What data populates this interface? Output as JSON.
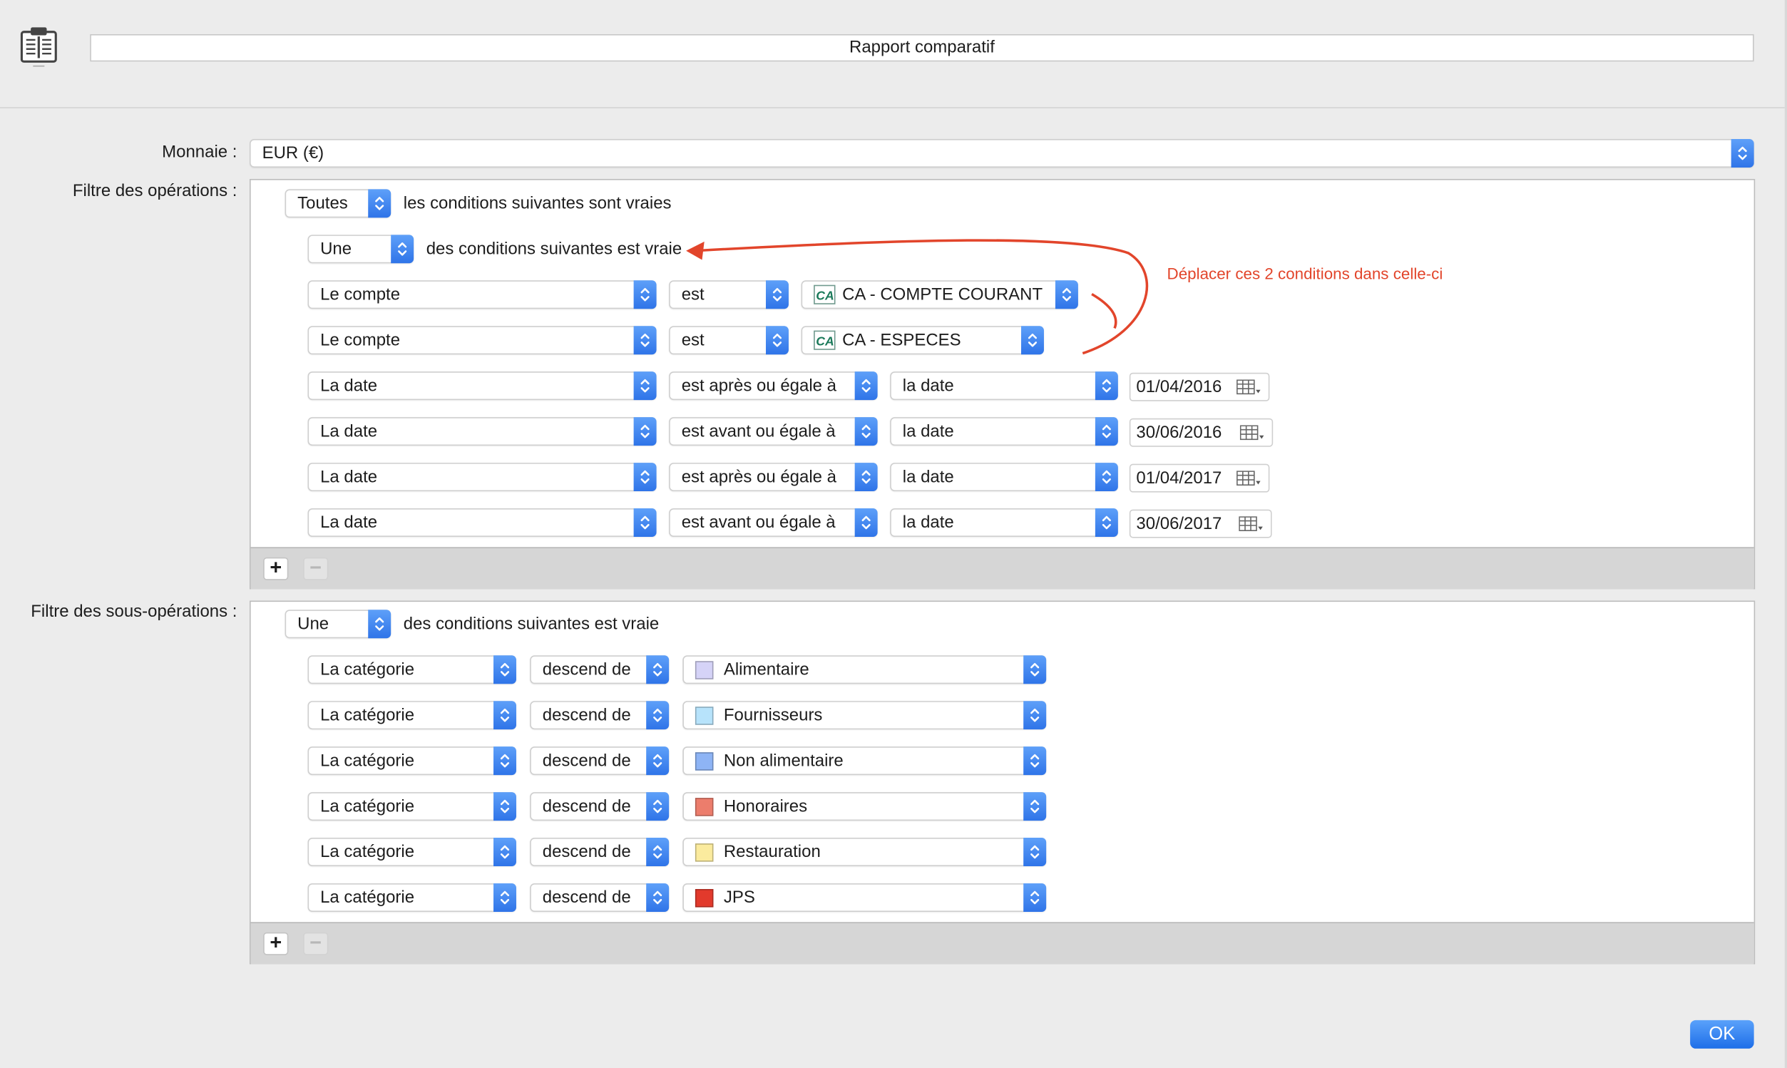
{
  "header": {
    "title": "Rapport comparatif",
    "doc_icon": "report-icon"
  },
  "currency": {
    "label": "Monnaie :",
    "value": "EUR (€)"
  },
  "ops_filter": {
    "label": "Filtre des opérations :",
    "match": {
      "value": "Toutes",
      "text": "les conditions suivantes sont vraies"
    },
    "group": {
      "value": "Une",
      "text": "des conditions suivantes est vraie"
    },
    "account_rows": [
      {
        "field": "Le compte",
        "op": "est",
        "value": "CA - COMPTE COURANT",
        "logo": "CA"
      },
      {
        "field": "Le compte",
        "op": "est",
        "value": "CA - ESPECES",
        "logo": "CA"
      }
    ],
    "date_rows": [
      {
        "field": "La date",
        "op": "est après ou égale à",
        "kind": "la date",
        "date": "01/04/2016"
      },
      {
        "field": "La date",
        "op": "est avant ou égale à",
        "kind": "la date",
        "date": "30/06/2016"
      },
      {
        "field": "La date",
        "op": "est après ou égale à",
        "kind": "la date",
        "date": "01/04/2017"
      },
      {
        "field": "La date",
        "op": "est avant ou égale à",
        "kind": "la date",
        "date": "30/06/2017"
      }
    ],
    "add": "+",
    "remove": "−"
  },
  "annotation": {
    "text": "Déplacer ces 2 conditions dans celle-ci",
    "color": "#e2452b"
  },
  "subops_filter": {
    "label": "Filtre des sous-opérations :",
    "match": {
      "value": "Une",
      "text": "des conditions suivantes est vraie"
    },
    "rows": [
      {
        "field": "La catégorie",
        "op": "descend de",
        "value": "Alimentaire",
        "color": "#d5d3f7"
      },
      {
        "field": "La catégorie",
        "op": "descend de",
        "value": "Fournisseurs",
        "color": "#b7e3fb"
      },
      {
        "field": "La catégorie",
        "op": "descend de",
        "value": "Non alimentaire",
        "color": "#8eb4f5"
      },
      {
        "field": "La catégorie",
        "op": "descend de",
        "value": "Honoraires",
        "color": "#ec7d6c"
      },
      {
        "field": "La catégorie",
        "op": "descend de",
        "value": "Restauration",
        "color": "#fbeb9e"
      },
      {
        "field": "La catégorie",
        "op": "descend de",
        "value": "JPS",
        "color": "#e23a2c"
      }
    ],
    "add": "+",
    "remove": "−"
  },
  "footer": {
    "ok_label": "OK"
  },
  "colors": {
    "accent": "#2f74e8"
  }
}
